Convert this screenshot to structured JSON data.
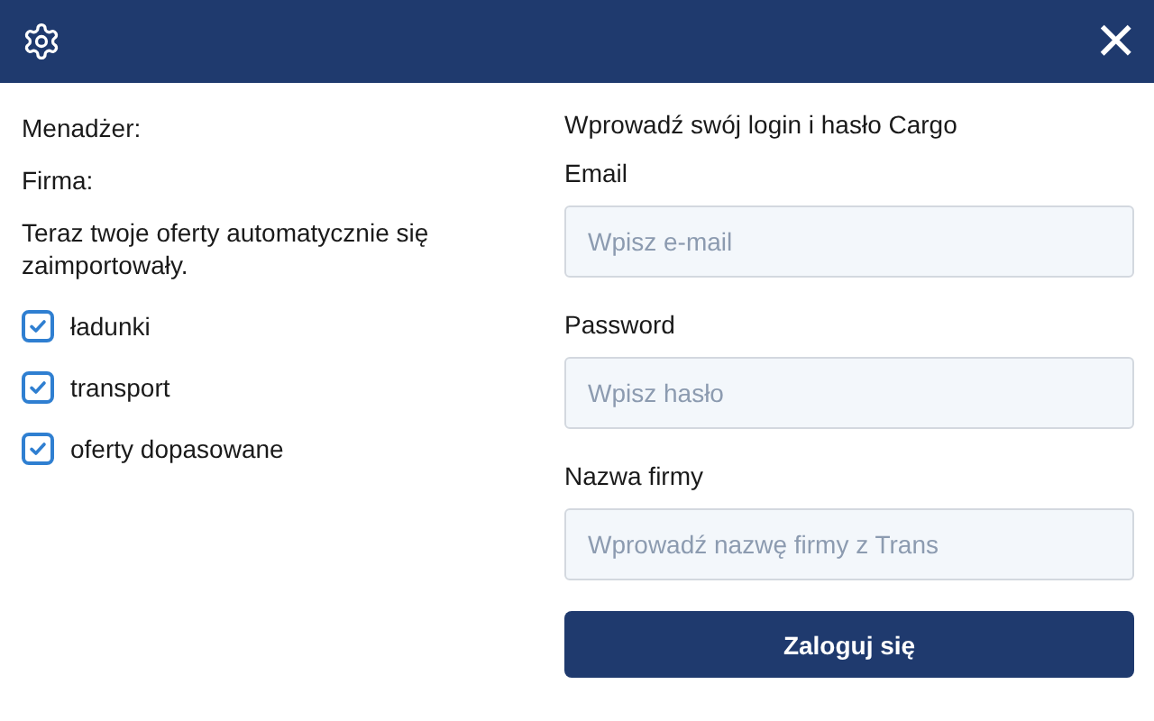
{
  "header": {
    "close": "×"
  },
  "left": {
    "manager_label": "Menadżer:",
    "company_label": "Firma:",
    "message": "Teraz twoje oferty automatycznie się zaimportowały.",
    "options": [
      {
        "label": "ładunki",
        "checked": true
      },
      {
        "label": "transport",
        "checked": true
      },
      {
        "label": "oferty dopasowane",
        "checked": true
      }
    ]
  },
  "form": {
    "heading": "Wprowadź swój login i hasło Cargo",
    "fields": [
      {
        "label": "Email",
        "placeholder": "Wpisz e-mail"
      },
      {
        "label": "Password",
        "placeholder": "Wpisz hasło"
      },
      {
        "label": "Nazwa firmy",
        "placeholder": "Wprowadź nazwę firmy z Trans"
      }
    ],
    "submit": "Zaloguj się"
  }
}
